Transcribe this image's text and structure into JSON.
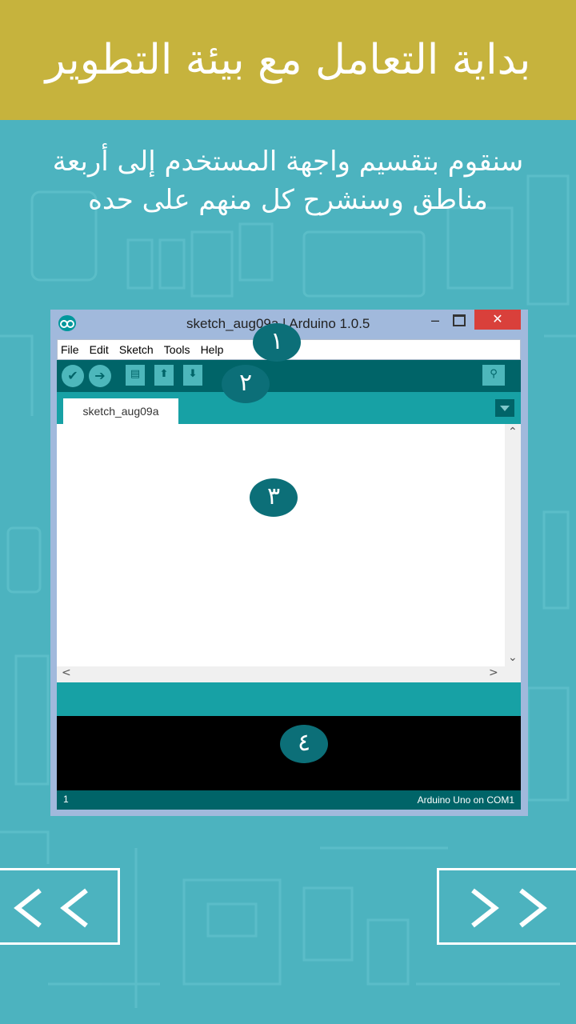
{
  "header": {
    "title": "بداية التعامل مع بيئة التطوير"
  },
  "intro": {
    "line1": "سنقوم بتقسيم واجهة المستخدم إلى أربعة",
    "line2": "مناطق وسنشرح كل منهم على حده"
  },
  "window": {
    "title": "sketch_aug09a | Arduino 1.0.5",
    "minimize": "–",
    "close": "✕",
    "menu": [
      "File",
      "Edit",
      "Sketch",
      "Tools",
      "Help"
    ],
    "tab": "sketch_aug09a",
    "line_number": "1",
    "board": "Arduino Uno on COM1"
  },
  "badges": [
    "١",
    "٢",
    "٣",
    "٤"
  ],
  "nav": {
    "prev_icon": "double-chevron-left-icon",
    "next_icon": "double-chevron-right-icon"
  },
  "colors": {
    "header": "#c6b33d",
    "background": "#4cb3bf",
    "arduino_dark": "#006468",
    "arduino_teal": "#17a1a5",
    "badge": "#0c6f78"
  }
}
